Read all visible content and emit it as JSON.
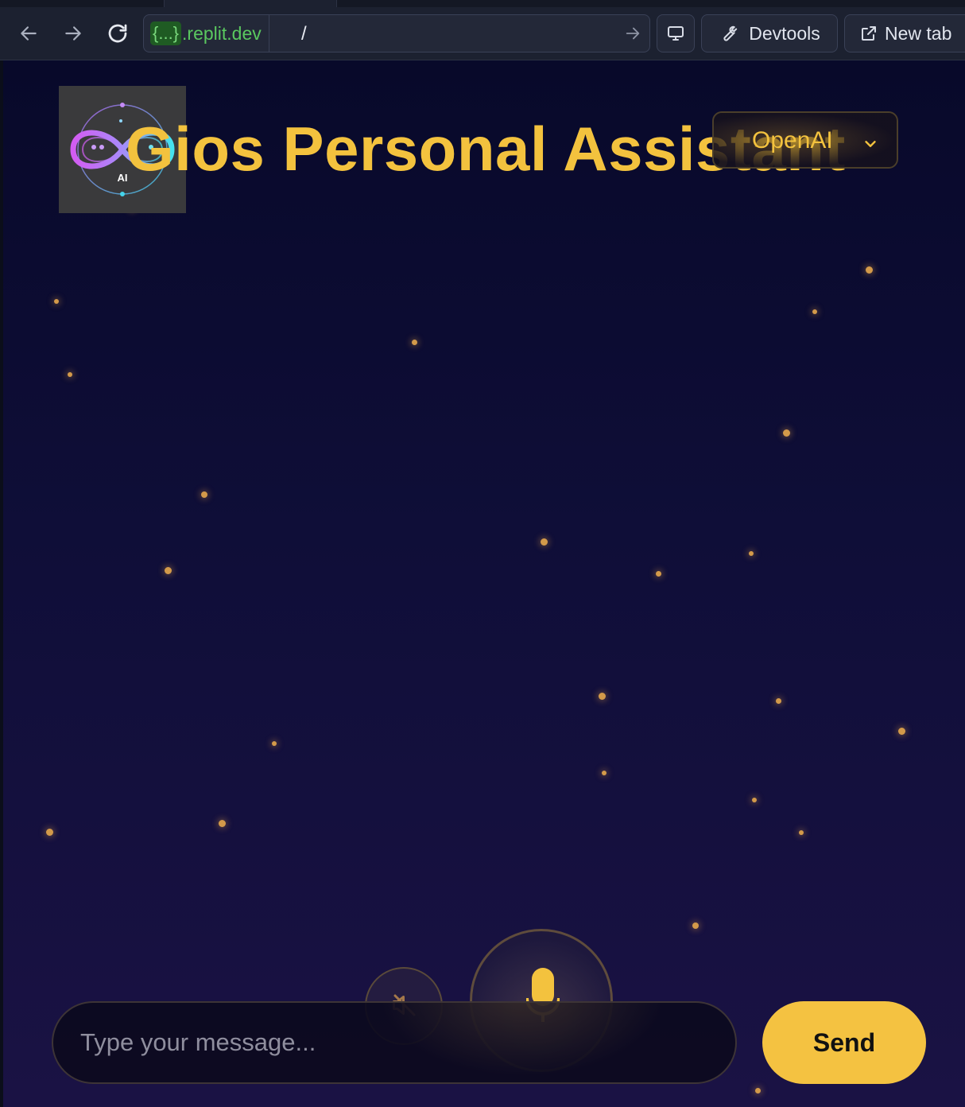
{
  "browser": {
    "url_host_badge": "{...}",
    "url_host": ".replit.dev",
    "url_path": "/",
    "devtools_label": "Devtools",
    "newtab_label": "New tab",
    "icons": [
      "back-arrow-icon",
      "forward-arrow-icon",
      "reload-icon",
      "go-arrow-icon",
      "monitor-icon",
      "wrench-icon",
      "external-link-icon"
    ]
  },
  "app": {
    "title": "Gios Personal Assistant",
    "logo_text": "AI",
    "model_selected": "OpenAI",
    "colors": {
      "accent": "#f3c23e",
      "background_top": "#08092a",
      "background_bottom": "#1a1244",
      "star": "#d39a4a"
    }
  },
  "controls": {
    "message_placeholder": "Type your message...",
    "message_value": "",
    "send_label": "Send",
    "speaker_icon": "speaker-off-icon",
    "mic_icon": "microphone-icon"
  }
}
